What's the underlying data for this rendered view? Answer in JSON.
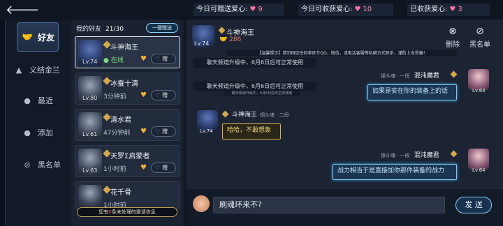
{
  "topbar": {
    "back_icon": "arrow-left-icon",
    "stats": [
      {
        "label": "今日可赠送爱心:",
        "value": "9"
      },
      {
        "label": "今日可收获爱心:",
        "value": "10"
      },
      {
        "label": "已收获爱心:",
        "value": "3"
      }
    ]
  },
  "nav": {
    "items": [
      {
        "label": "好友",
        "icon": "handshake-icon"
      },
      {
        "label": "义结金兰",
        "icon": "ring-icon"
      },
      {
        "label": "最近",
        "icon": "user-clock-icon"
      },
      {
        "label": "添加",
        "icon": "user-plus-icon"
      },
      {
        "label": "黑名单",
        "icon": "block-icon"
      }
    ]
  },
  "friends": {
    "title": "我的好友",
    "count": "21/30",
    "gift_all": "一键赠送",
    "notice_prefix": "您有",
    "notice_count": "0",
    "notice_suffix": "条未处理的邀请信息",
    "list": [
      {
        "name": "斗神海王",
        "level": "Lv.74",
        "status": "在线",
        "give": "赠"
      },
      {
        "name": "冰蚕十清",
        "level": "Lv.80",
        "status": "3分钟前",
        "give": "赠"
      },
      {
        "name": "清水君",
        "level": "Lv.61",
        "status": "47分钟前",
        "give": "赠"
      },
      {
        "name": "天罗Σ启蒙者",
        "level": "Lv.63",
        "status": "1小时前",
        "give": "赠"
      },
      {
        "name": "花千骨",
        "level": "",
        "status": "1小时前",
        "give": "赠"
      }
    ]
  },
  "chat": {
    "header": {
      "name": "斗神海王",
      "level": "Lv.74",
      "hearts": "286"
    },
    "actions": {
      "delete": "删除",
      "blacklist": "黑名单"
    },
    "system_notice": "【温馨提示】请勿相信任何非官方QQ、微信，或电话客服等私聊方式联系，谨防上当受骗！",
    "system_upgrade_1": "聊天频道升级中，6月6日后可正常使用",
    "system_upgrade_2": "聊天频道升级中，6月6日后可正常使用",
    "system_upgrade_small": "聊天频道升级中，6月6日后可正常使用",
    "messages": [
      {
        "side": "right",
        "sender": "混沌魔君",
        "sub": "银斗魂 · 一段",
        "level": "Lv.64",
        "text": "如果是安在你的装备上的话"
      },
      {
        "side": "left",
        "sender": "斗神海王",
        "sub": "铜斗魂 · 二段",
        "level": "Lv.74",
        "text": "哈哈，不敢想象"
      },
      {
        "side": "right",
        "sender": "混沌魔君",
        "sub": "银斗魂 · 一段",
        "level": "Lv.64",
        "text": "战力相当于是直接加你那件装备的战力"
      }
    ],
    "input_value": "刷魂环来不?",
    "send_label": "发 送"
  }
}
